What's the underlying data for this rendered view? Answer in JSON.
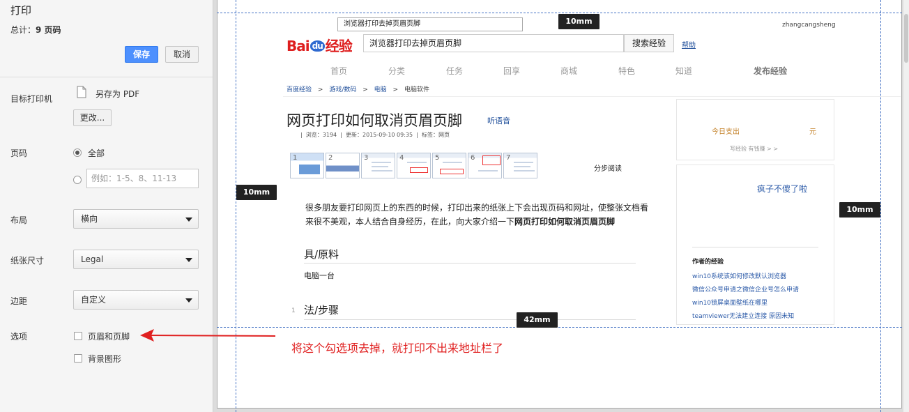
{
  "panel": {
    "title": "打印",
    "total_prefix": "总计：",
    "total_value": "9 页码",
    "save": "保存",
    "cancel": "取消",
    "printer_label": "目标打印机",
    "printer_value": "另存为 PDF",
    "change": "更改...",
    "pages_label": "页码",
    "pages_all": "全部",
    "pages_placeholder": "例如：1-5、8、11-13",
    "layout_label": "布局",
    "layout_value": "横向",
    "paper_label": "纸张尺寸",
    "paper_value": "Legal",
    "margin_label": "边距",
    "margin_value": "自定义",
    "options_label": "选项",
    "opt_header_footer": "页眉和页脚",
    "opt_background": "背景图形"
  },
  "annotation": {
    "text": "将这个勾选项去掉，就打印不出来地址栏了",
    "color": "#e02020"
  },
  "margins": {
    "top": "10mm",
    "left": "10mm",
    "right": "10mm",
    "bottom": "42mm"
  },
  "page": {
    "header_title": "浏览器打印去掉页眉页脚",
    "header_user": "zhangcangsheng",
    "logo_text_1": "Bai",
    "logo_text_2": "du",
    "logo_text_3": "经验",
    "search_value": "浏览器打印去掉页眉页脚",
    "search_button": "搜索经验",
    "help": "帮助",
    "nav": [
      "首页",
      "分类",
      "任务",
      "回享",
      "商城",
      "特色",
      "知道",
      "发布经验"
    ],
    "breadcrumb": [
      "百度经验",
      "游戏/数码",
      "电脑",
      "电脑软件"
    ],
    "crumb_sep": ">",
    "article_title": "网页打印如何取消页眉页脚",
    "listen": "听语音",
    "meta": "|  浏览：3194  |  更新：2015-09-10 09:35  |  标签：网页",
    "step_read": "分步阅读",
    "thumb_numbers": [
      "1",
      "2",
      "3",
      "4",
      "5",
      "6",
      "7"
    ],
    "intro_1": "很多朋友要打印网页上的东西的时候，打印出来的纸张上下会出现页码和网址，使整张文档看",
    "intro_2": "来很不美观，本人结合自身经历，在此，向大家介绍一下",
    "intro_bold": "网页打印如何取消页眉页脚",
    "section_tools": "具/原料",
    "tool_item": "电脑一台",
    "step_number": "1",
    "section_steps": "法/步骤",
    "sidebar_today": "今日支出",
    "sidebar_currency": "元",
    "sidebar_sub": "写经验 有钱赚 > >",
    "author_name": "疯子不傻了啦",
    "author_section": "作者的经验",
    "author_links": [
      "win10系统该如何修改默认浏览器",
      "微信公众号申请之微信企业号怎么申请",
      "win10锁屏桌面壁纸在哪里",
      "teamviewer无法建立连接 原因未知"
    ]
  }
}
